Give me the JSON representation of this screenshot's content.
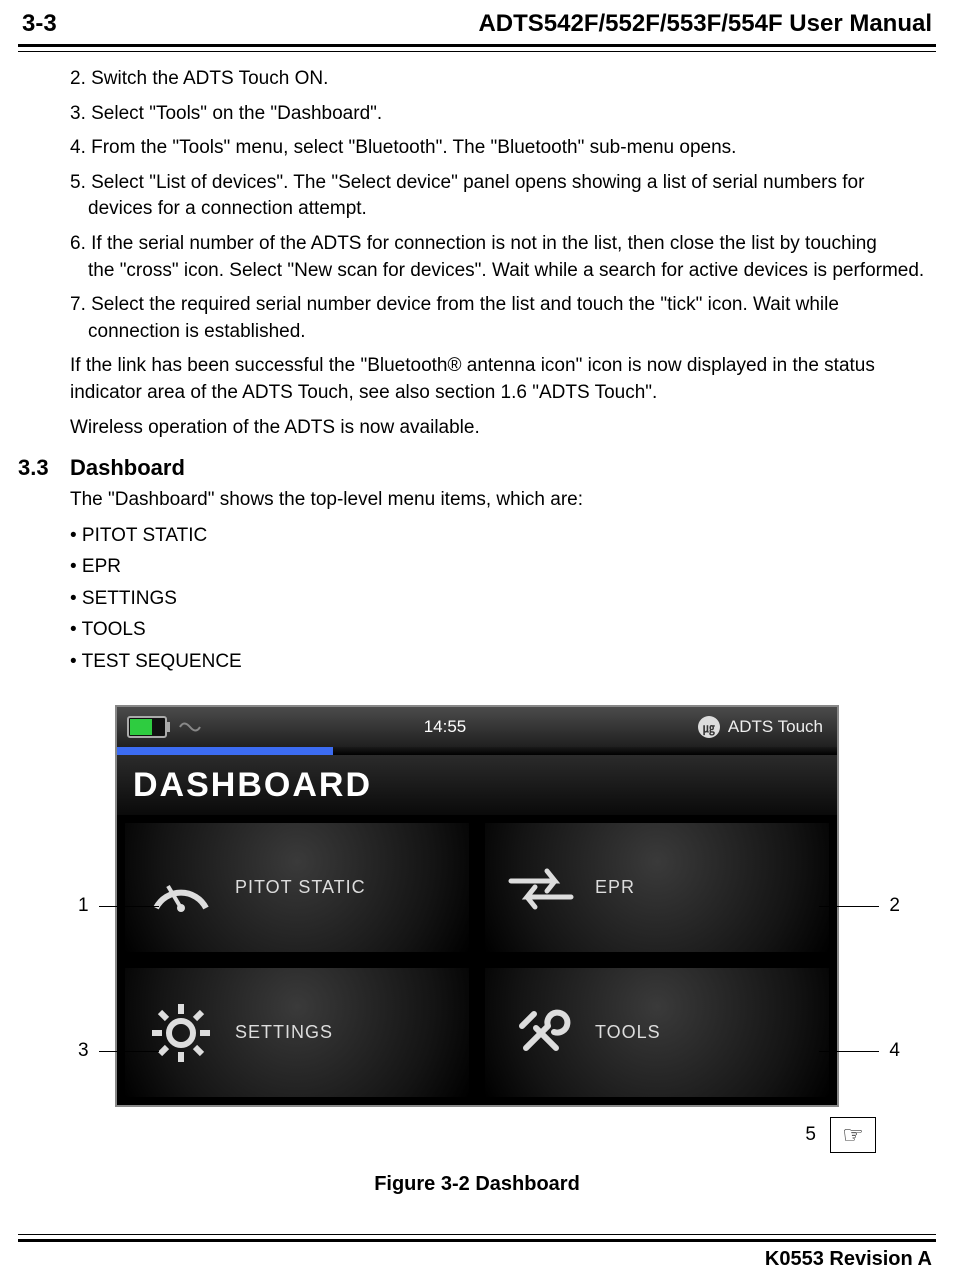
{
  "header": {
    "page_num": "3-3",
    "title": "ADTS542F/552F/553F/554F User Manual"
  },
  "steps": {
    "s2": "2. Switch the ADTS Touch ON.",
    "s3": "3. Select \"Tools\" on the \"Dashboard\".",
    "s4": "4. From the \"Tools\" menu, select \"Bluetooth\". The \"Bluetooth\" sub-menu opens.",
    "s5a": "5. Select \"List of devices\". The \"Select device\" panel opens showing a list of serial numbers for",
    "s5b": "devices for a connection attempt.",
    "s6a": "6. If the serial number of the ADTS for connection is not in the list, then close the list by touching",
    "s6b": "the \"cross\" icon. Select \"New scan for devices\". Wait while a search for active devices is performed.",
    "s7a": "7. Select the required serial number device from the list and touch the \"tick\" icon. Wait while",
    "s7b": "connection is established."
  },
  "paras": {
    "p1": "If the link has been successful the \"Bluetooth® antenna icon\" icon is now displayed in the status indicator area of the ADTS Touch, see also section 1.6 \"ADTS Touch\".",
    "p2": "Wireless operation of the ADTS is now available."
  },
  "section": {
    "num": "3.3",
    "title": "Dashboard",
    "intro": "The \"Dashboard\" shows the top-level menu items, which are:"
  },
  "bullets": {
    "b1": "• PITOT STATIC",
    "b2": "• EPR",
    "b3": "• SETTINGS",
    "b4": "• TOOLS",
    "b5": "• TEST SEQUENCE"
  },
  "device_ui": {
    "time": "14:55",
    "brand": "ADTS Touch",
    "dash_title": "DASHBOARD",
    "tile1": "PITOT STATIC",
    "tile2": "EPR",
    "tile3": "SETTINGS",
    "tile4": "TOOLS"
  },
  "callouts": {
    "c1": "1",
    "c2": "2",
    "c3": "3",
    "c4": "4",
    "c5": "5"
  },
  "figure_caption": "Figure 3-2 Dashboard",
  "footer": "K0553 Revision A"
}
